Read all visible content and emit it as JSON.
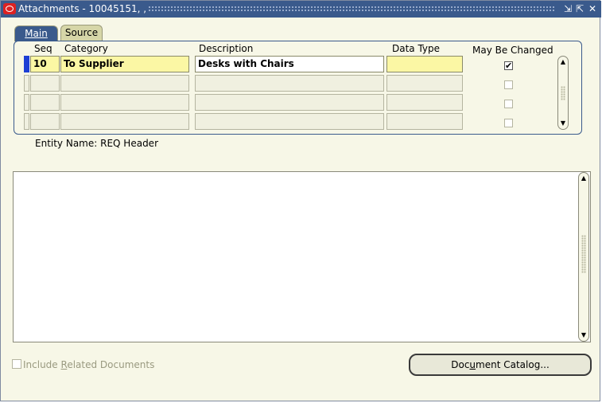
{
  "window": {
    "title": "Attachments - 10045151, ,",
    "minimize_label": "⇲",
    "maximize_label": "⇱",
    "close_label": "✕"
  },
  "tabs": [
    {
      "label": "Main",
      "active": true
    },
    {
      "label": "Source",
      "active": false
    }
  ],
  "grid": {
    "headers": {
      "seq": "Seq",
      "category": "Category",
      "description": "Description",
      "data_type": "Data Type",
      "may_be_changed": "May Be Changed"
    },
    "rows": [
      {
        "seq": "10",
        "category": "To Supplier",
        "description": "Desks with Chairs",
        "data_type": "",
        "may_be_changed": true
      },
      {
        "seq": "",
        "category": "",
        "description": "",
        "data_type": "",
        "may_be_changed": false
      },
      {
        "seq": "",
        "category": "",
        "description": "",
        "data_type": "",
        "may_be_changed": false
      },
      {
        "seq": "",
        "category": "",
        "description": "",
        "data_type": "",
        "may_be_changed": false
      }
    ]
  },
  "entity": {
    "label": "Entity Name:",
    "value": "REQ Header"
  },
  "content_text": "",
  "include_related": {
    "pre": "Include ",
    "underlined": "R",
    "post": "elated Documents",
    "checked": false
  },
  "document_catalog": {
    "pre": "Doc",
    "underlined": "u",
    "post": "ment Catalog..."
  },
  "colors": {
    "title_bar": "#3a5a8c",
    "required_field": "#fbf7a4",
    "background": "#f7f7e7",
    "current_record": "#1d3fd4"
  }
}
